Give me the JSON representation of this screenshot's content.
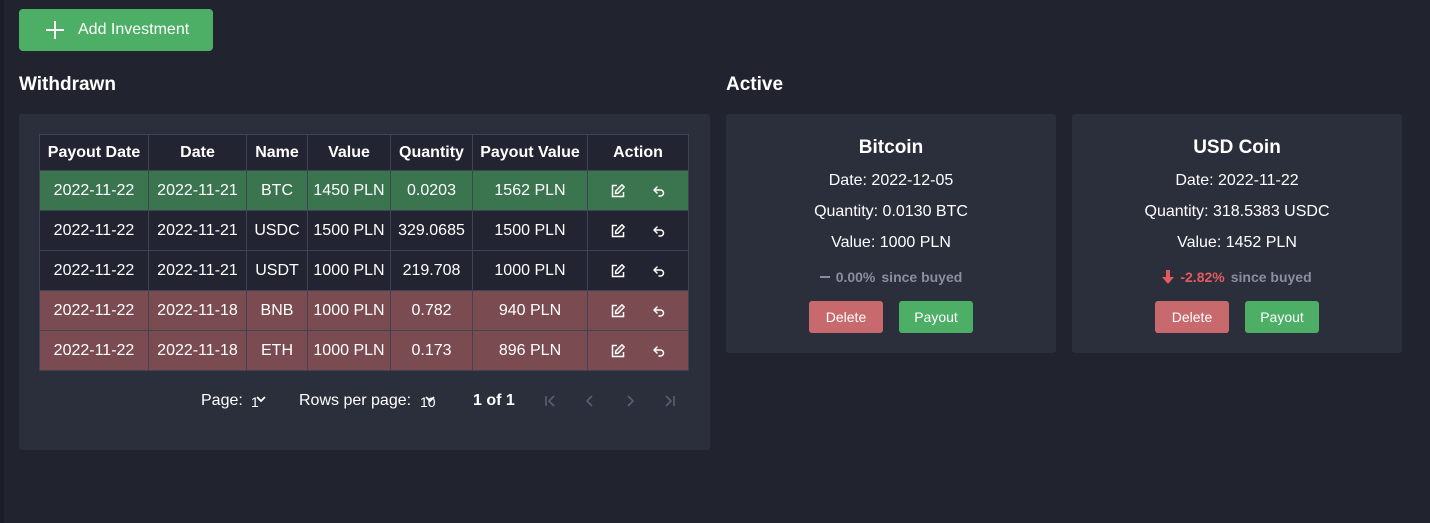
{
  "toolbar": {
    "add_label": "Add Investment"
  },
  "withdrawn": {
    "title": "Withdrawn",
    "columns": [
      "Payout Date",
      "Date",
      "Name",
      "Value",
      "Quantity",
      "Payout Value",
      "Action"
    ],
    "rows": [
      {
        "payout_date": "2022-11-22",
        "date": "2022-11-21",
        "name": "BTC",
        "value": "1450 PLN",
        "quantity": "0.0203",
        "payout_value": "1562 PLN",
        "status": "profit"
      },
      {
        "payout_date": "2022-11-22",
        "date": "2022-11-21",
        "name": "USDC",
        "value": "1500 PLN",
        "quantity": "329.0685",
        "payout_value": "1500 PLN",
        "status": "neutral"
      },
      {
        "payout_date": "2022-11-22",
        "date": "2022-11-21",
        "name": "USDT",
        "value": "1000 PLN",
        "quantity": "219.708",
        "payout_value": "1000 PLN",
        "status": "neutral"
      },
      {
        "payout_date": "2022-11-22",
        "date": "2022-11-18",
        "name": "BNB",
        "value": "1000 PLN",
        "quantity": "0.782",
        "payout_value": "940 PLN",
        "status": "loss"
      },
      {
        "payout_date": "2022-11-22",
        "date": "2022-11-18",
        "name": "ETH",
        "value": "1000 PLN",
        "quantity": "0.173",
        "payout_value": "896 PLN",
        "status": "loss"
      }
    ],
    "pagination": {
      "page_label": "Page:",
      "page_value": "1",
      "rows_label": "Rows per page:",
      "rows_value": "10",
      "count": "1 of 1"
    }
  },
  "active": {
    "title": "Active",
    "cards": [
      {
        "name": "Bitcoin",
        "date": "Date: 2022-12-05",
        "quantity": "Quantity: 0.0130 BTC",
        "value": "Value: 1000 PLN",
        "change": "0.00%",
        "change_direction": "neutral",
        "since": "since buyed",
        "delete_label": "Delete",
        "payout_label": "Payout"
      },
      {
        "name": "USD Coin",
        "date": "Date: 2022-11-22",
        "quantity": "Quantity: 318.5383 USDC",
        "value": "Value: 1452 PLN",
        "change": "-2.82%",
        "change_direction": "down",
        "since": "since buyed",
        "delete_label": "Delete",
        "payout_label": "Payout"
      }
    ]
  },
  "colors": {
    "background": "#21232e",
    "panel": "#2b2e3b",
    "accent_green": "#4caf65",
    "delete_red": "#c86a6d",
    "row_profit": "#3b7550",
    "row_loss": "#7a4c51",
    "negative_text": "#e45a5f"
  },
  "icons": {
    "add": "plus-icon",
    "edit": "edit-icon",
    "undo": "undo-icon",
    "first": "first-page-icon",
    "prev": "prev-page-icon",
    "next": "next-page-icon",
    "last": "last-page-icon"
  }
}
